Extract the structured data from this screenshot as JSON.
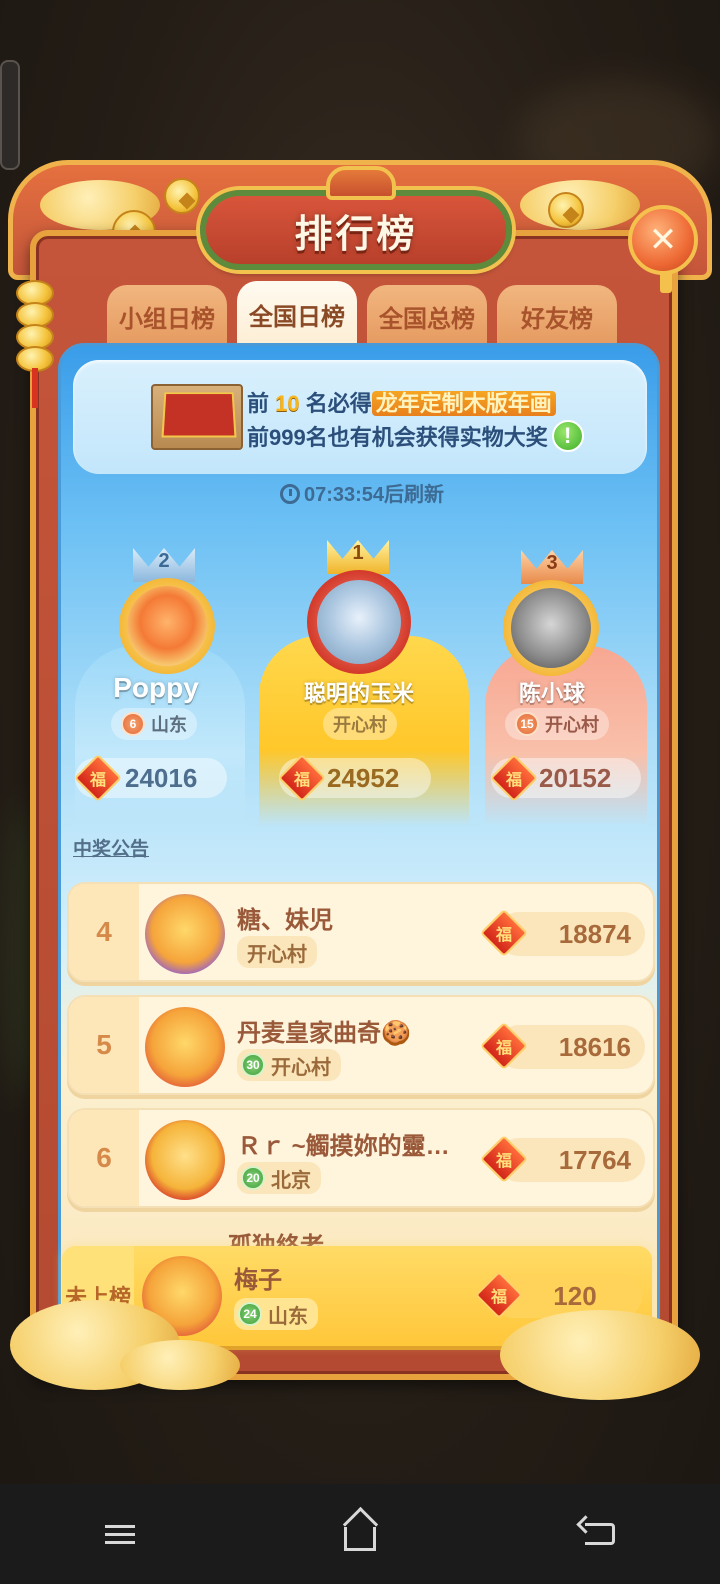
{
  "header": {
    "title": "排行榜",
    "close_symbol": "✕"
  },
  "tabs": [
    {
      "label": "小组日榜",
      "active": false
    },
    {
      "label": "全国日榜",
      "active": true
    },
    {
      "label": "全国总榜",
      "active": false
    },
    {
      "label": "好友榜",
      "active": false
    }
  ],
  "promo": {
    "line1_prefix": "前",
    "line1_top_n": "10",
    "line1_mid": "名必得",
    "line1_prize": "龙年定制木版年画",
    "line2": "前999名也有机会获得实物大奖",
    "info_symbol": "!"
  },
  "timer": {
    "countdown": "07:33:54",
    "suffix": "后刷新"
  },
  "podium": [
    {
      "rank": "2",
      "name": "Poppy",
      "level": "6",
      "location": "山东",
      "score": "24016"
    },
    {
      "rank": "1",
      "name": "聪明的玉米",
      "level": "",
      "location": "开心村",
      "score": "24952"
    },
    {
      "rank": "3",
      "name": "陈小球",
      "level": "15",
      "location": "开心村",
      "score": "20152"
    }
  ],
  "notice_link": "中奖公告",
  "fu_char": "福",
  "list": [
    {
      "rank": "4",
      "name": "糖、妹児",
      "level": "",
      "location": "开心村",
      "score": "18874"
    },
    {
      "rank": "5",
      "name": "丹麦皇家曲奇🍪",
      "level": "30",
      "location": "开心村",
      "score": "18616"
    },
    {
      "rank": "6",
      "name": "Ｒｒ ~觸摸妳的靈…",
      "level": "20",
      "location": "北京",
      "score": "17764"
    }
  ],
  "partial_next_name": "孤独終老",
  "me": {
    "rank_label": "未上榜",
    "name": "梅子",
    "level": "24",
    "location": "山东",
    "score": "120"
  },
  "colors": {
    "frame": "#c4553a",
    "gold": "#f1c24e",
    "blue_panel": "#6cc0f4",
    "accent_orange": "#f5a623"
  },
  "icons": {
    "nav_menu": "menu-icon",
    "nav_home": "home-icon",
    "nav_back": "back-icon",
    "clock": "clock-icon",
    "fu_badge": "fu-badge-icon"
  }
}
